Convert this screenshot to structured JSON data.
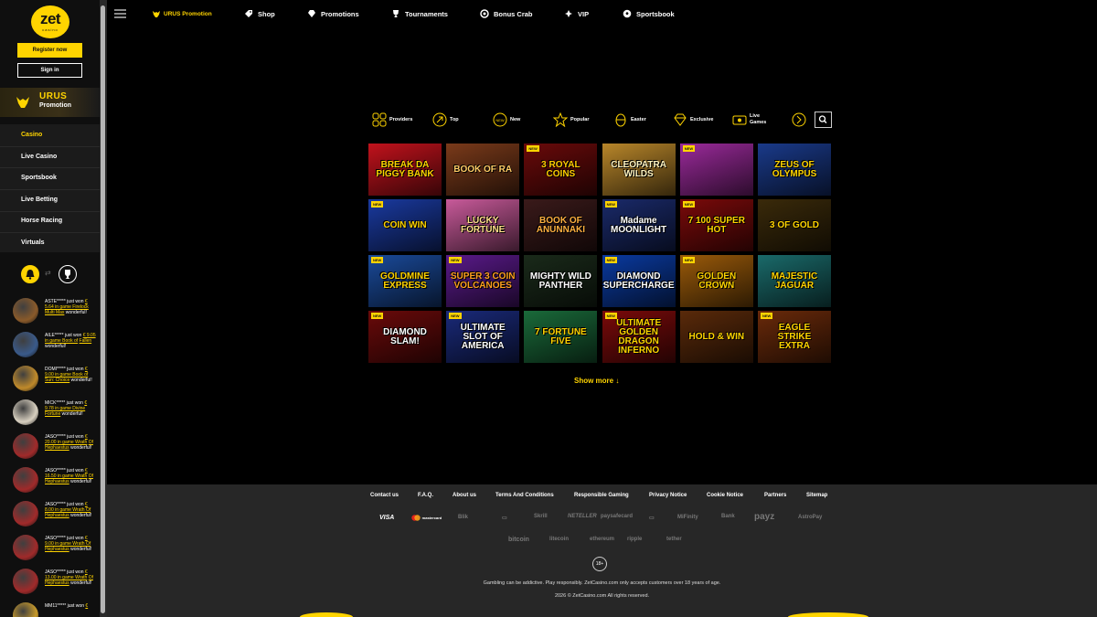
{
  "brand": {
    "logo_word": "zet",
    "logo_sub": "casino"
  },
  "auth": {
    "register_label": "Register now",
    "signin_label": "Sign in"
  },
  "urus": {
    "line1": "URUS",
    "line2": "Promotion"
  },
  "sidebar": {
    "items": [
      {
        "label": "Casino",
        "active": true
      },
      {
        "label": "Live Casino"
      },
      {
        "label": "Sportsbook"
      },
      {
        "label": "Live Betting"
      },
      {
        "label": "Horse Racing"
      },
      {
        "label": "Virtuals"
      }
    ]
  },
  "wins": [
    {
      "user": "ASTE*****",
      "amount": "€ 5.64 in game Firelock",
      "game": "Multi Max",
      "tail": "wonderful!",
      "color": "#8a5a2a"
    },
    {
      "user": "AILE*****",
      "amount": "€ 9.05 in game Book of",
      "game": "Fallen",
      "tail": "wonderful!",
      "color": "#3a5a8a"
    },
    {
      "user": "DOMI*****",
      "amount": "€ 9.00 in game Book of",
      "game": "Sun: Choice",
      "tail": "wonderful!",
      "color": "#c08a2a"
    },
    {
      "user": "MICK*****",
      "amount": "€ 9.78 in game Divine",
      "game": "Fortune",
      "tail": "wonderful!",
      "color": "#d8d0c0"
    },
    {
      "user": "JASO*****",
      "amount": "€ 20.00 in game Wrath",
      "game": "Of Hephaestus",
      "tail": "wonderful!",
      "color": "#a02a2a"
    },
    {
      "user": "JASO*****",
      "amount": "€ 16.50 in game Wrath",
      "game": "Of Hephaestus",
      "tail": "wonderful!",
      "color": "#a02a2a"
    },
    {
      "user": "JASO*****",
      "amount": "€ 8.00 in game Wrath Of",
      "game": "Hephaestus",
      "tail": "wonderful!",
      "color": "#a02a2a"
    },
    {
      "user": "JASO*****",
      "amount": "€ 9.00 in game Wrath Of",
      "game": "Hephaestus",
      "tail": "wonderful!",
      "color": "#a02a2a"
    },
    {
      "user": "JASO*****",
      "amount": "€ 13.00 in game Wrath",
      "game": "Of Hephaestus",
      "tail": "wonderful!",
      "color": "#a02a2a"
    },
    {
      "user": "MM11*****",
      "amount": "€",
      "game": "",
      "tail": "",
      "color": "#c89a2a"
    }
  ],
  "wins_just_won": "just won",
  "topnav": {
    "promo": "URUS Promotion",
    "shop": "Shop",
    "promotions": "Promotions",
    "tournaments": "Tournaments",
    "bonus_crab": "Bonus Crab",
    "vip": "VIP",
    "sportsbook": "Sportsbook"
  },
  "categories": {
    "providers": "Providers",
    "top": "Top",
    "new": "New",
    "popular": "Popular",
    "easter": "Easter",
    "exclusive": "Exclusive",
    "live_games_1": "Live",
    "live_games_2": "Games"
  },
  "new_badge": "NEW",
  "games": [
    {
      "title": "BREAK DA PIGGY BANK",
      "bg": "#c1121c",
      "fg": "#ffd400",
      "new": false
    },
    {
      "title": "BOOK OF RA",
      "bg": "#7a3a1a",
      "fg": "#ffcc66",
      "new": false
    },
    {
      "title": "3 ROYAL COINS",
      "bg": "#6a0a0a",
      "fg": "#ffcc00",
      "new": true
    },
    {
      "title": "CLEOPATRA WILDS",
      "bg": "#b8862a",
      "fg": "#fff4c0",
      "new": false
    },
    {
      "title": "",
      "bg": "#9a2a9a",
      "fg": "#fff",
      "new": true
    },
    {
      "title": "ZEUS OF OLYMPUS",
      "bg": "#1a3a8a",
      "fg": "#ffd400",
      "new": false
    },
    {
      "title": "COIN WIN",
      "bg": "#1a3aa0",
      "fg": "#ffd400",
      "new": true
    },
    {
      "title": "LUCKY FORTUNE",
      "bg": "#c85a9a",
      "fg": "#ffe08a",
      "new": false
    },
    {
      "title": "BOOK OF ANUNNAKI",
      "bg": "#3a1a1a",
      "fg": "#ffb040",
      "new": false
    },
    {
      "title": "Madame MOONLIGHT",
      "bg": "#1a2a6a",
      "fg": "#fff",
      "new": true
    },
    {
      "title": "7 100 SUPER HOT",
      "bg": "#7a0a0a",
      "fg": "#ffd400",
      "new": true
    },
    {
      "title": "3 OF GOLD",
      "bg": "#3a2a0a",
      "fg": "#ffd400",
      "new": false
    },
    {
      "title": "GOLDMINE EXPRESS",
      "bg": "#1a4a9a",
      "fg": "#ffd400",
      "new": true
    },
    {
      "title": "SUPER 3 COIN VOLCANOES",
      "bg": "#5a1a8a",
      "fg": "#ffa020",
      "new": true
    },
    {
      "title": "MIGHTY WILD PANTHER",
      "bg": "#1a2a1a",
      "fg": "#fff",
      "new": false
    },
    {
      "title": "DIAMOND SUPERCHARGE",
      "bg": "#0a3aa0",
      "fg": "#fff",
      "new": true
    },
    {
      "title": "GOLDEN CROWN",
      "bg": "#9a5a0a",
      "fg": "#ffd400",
      "new": true
    },
    {
      "title": "MAJESTIC JAGUAR",
      "bg": "#1a6a6a",
      "fg": "#ffd400",
      "new": false
    },
    {
      "title": "DIAMOND SLAM!",
      "bg": "#6a0a0a",
      "fg": "#fff",
      "new": true
    },
    {
      "title": "ULTIMATE SLOT OF AMERICA",
      "bg": "#1a2a7a",
      "fg": "#fff",
      "new": true
    },
    {
      "title": "7 FORTUNE FIVE",
      "bg": "#1a6a3a",
      "fg": "#ffd400",
      "new": false
    },
    {
      "title": "ULTIMATE GOLDEN DRAGON INFERNO",
      "bg": "#7a0a0a",
      "fg": "#ffd400",
      "new": true
    },
    {
      "title": "HOLD & WIN",
      "bg": "#5a2a0a",
      "fg": "#ffd400",
      "new": false
    },
    {
      "title": "EAGLE STRIKE EXTRA",
      "bg": "#6a2a0a",
      "fg": "#ffd400",
      "new": true
    }
  ],
  "show_more": "Show more ↓",
  "footer": {
    "links": [
      "Contact us",
      "F.A.Q.",
      "About us",
      "Terms And Conditions",
      "Responsible Gaming",
      "Privacy Notice",
      "Cookie Notice",
      "Partners",
      "Sitemap"
    ],
    "payments_row1": [
      "VISA",
      "mastercard",
      "Blik",
      "▭",
      "Skrill",
      "NETELLER",
      "paysafecard",
      "▭",
      "MiFinity",
      "Bank",
      "payz",
      "AstroPay"
    ],
    "payments_row2": [
      "bitcoin",
      "litecoin",
      "ethereum",
      "ripple",
      "tether"
    ],
    "age": "18+",
    "disclaimer": "Gambling can be addictive. Play responsibly. ZetCasino.com only accepts customers over 18 years of age.",
    "copyright": "2026 © ZetCasino.com All rights reserved."
  }
}
